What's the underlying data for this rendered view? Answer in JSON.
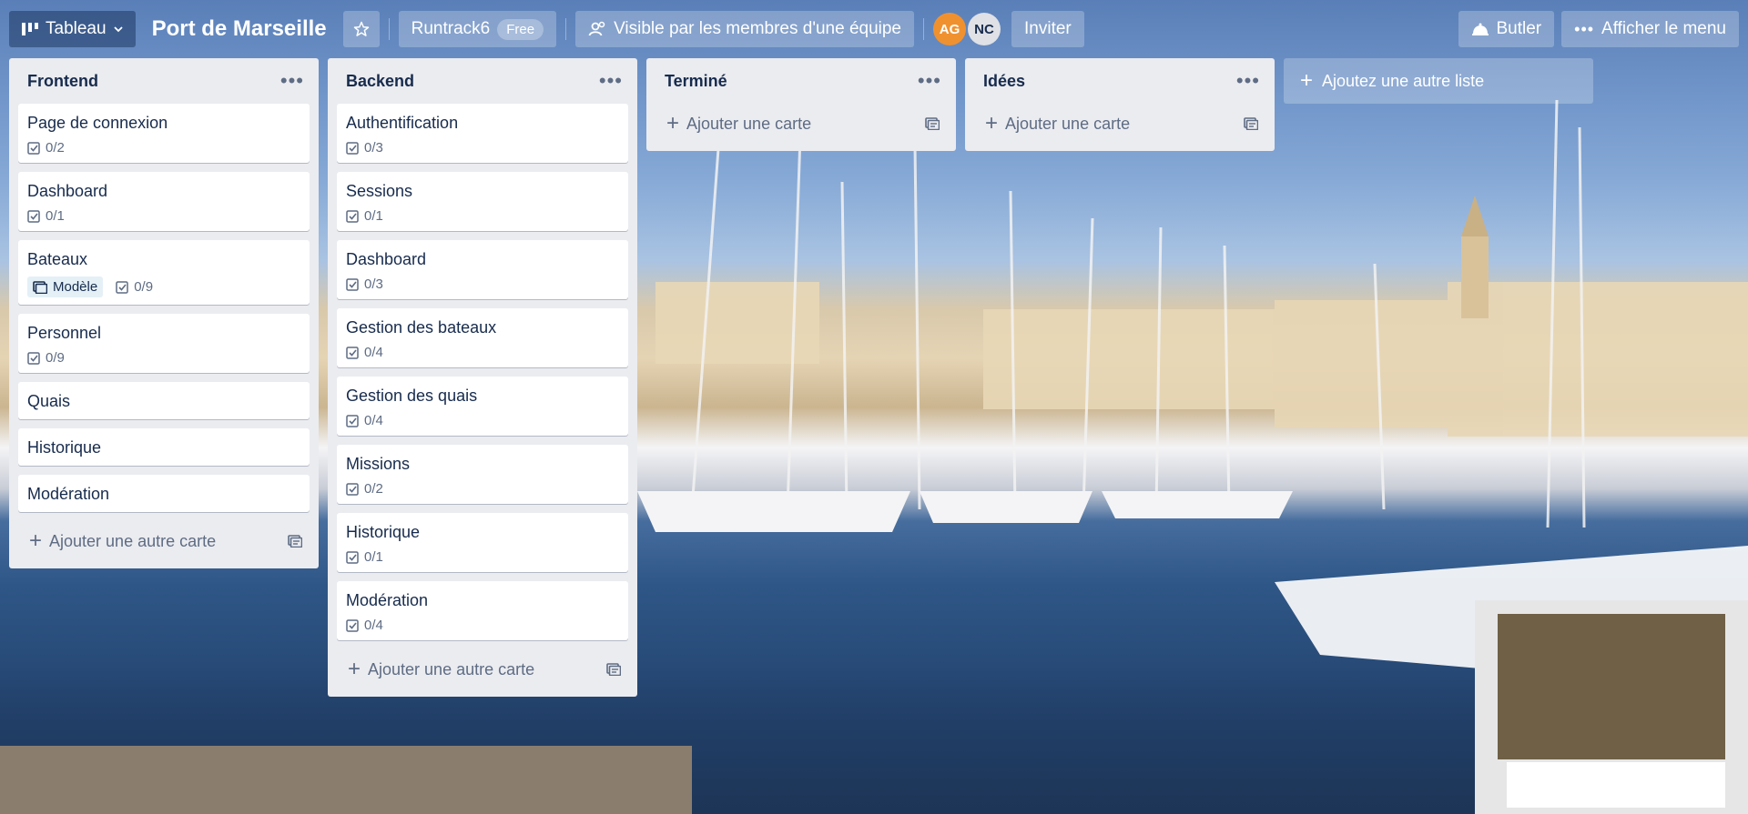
{
  "header": {
    "view_switcher_label": "Tableau",
    "board_title": "Port de Marseille",
    "workspace_name": "Runtrack6",
    "plan_badge": "Free",
    "visibility_label": "Visible par les membres d'une équipe",
    "members": [
      {
        "initials": "AG",
        "color": "#f0912f"
      },
      {
        "initials": "NC",
        "color": "#dfe1e6"
      }
    ],
    "invite_label": "Inviter",
    "butler_label": "Butler",
    "menu_label": "Afficher le menu"
  },
  "lists": [
    {
      "title": "Frontend",
      "cards": [
        {
          "title": "Page de connexion",
          "checklist": "0/2"
        },
        {
          "title": "Dashboard",
          "checklist": "0/1"
        },
        {
          "title": "Bateaux",
          "template": "Modèle",
          "checklist": "0/9"
        },
        {
          "title": "Personnel",
          "checklist": "0/9"
        },
        {
          "title": "Quais"
        },
        {
          "title": "Historique"
        },
        {
          "title": "Modération"
        }
      ],
      "add_label": "Ajouter une autre carte"
    },
    {
      "title": "Backend",
      "cards": [
        {
          "title": "Authentification",
          "checklist": "0/3"
        },
        {
          "title": "Sessions",
          "checklist": "0/1"
        },
        {
          "title": "Dashboard",
          "checklist": "0/3"
        },
        {
          "title": "Gestion des bateaux",
          "checklist": "0/4"
        },
        {
          "title": "Gestion des quais",
          "checklist": "0/4"
        },
        {
          "title": "Missions",
          "checklist": "0/2"
        },
        {
          "title": "Historique",
          "checklist": "0/1"
        },
        {
          "title": "Modération",
          "checklist": "0/4"
        }
      ],
      "add_label": "Ajouter une autre carte"
    },
    {
      "title": "Terminé",
      "cards": [],
      "add_label": "Ajouter une carte"
    },
    {
      "title": "Idées",
      "cards": [],
      "add_label": "Ajouter une carte"
    }
  ],
  "add_list_label": "Ajoutez une autre liste",
  "icons": {
    "list_menu": "ellipsis-icon",
    "checklist": "checkbox-icon",
    "template": "template-card-icon",
    "card_composer": "card-template-icon"
  }
}
